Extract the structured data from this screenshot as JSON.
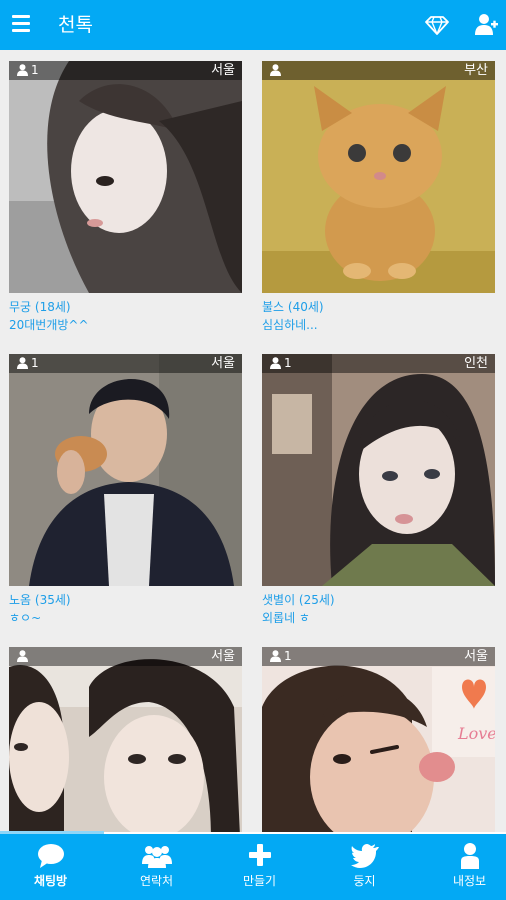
{
  "app": {
    "title": "천톡"
  },
  "header_icons": [
    "menu-icon",
    "diamond-icon",
    "add-user-icon"
  ],
  "rooms": [
    {
      "region": "서울",
      "count": "1",
      "name_age": "무궁 (18세)",
      "message": "20대번개방^^"
    },
    {
      "region": "부산",
      "count": "",
      "name_age": "불스 (40세)",
      "message": "심심하네..."
    },
    {
      "region": "서울",
      "count": "1",
      "name_age": "노옴 (35세)",
      "message": "ㅎㅇ~"
    },
    {
      "region": "인천",
      "count": "1",
      "name_age": "샛별이 (25세)",
      "message": "외롭네 ㅎ"
    },
    {
      "region": "서울",
      "count": "",
      "name_age": "",
      "message": ""
    },
    {
      "region": "서울",
      "count": "1",
      "name_age": "",
      "message": ""
    }
  ],
  "bottom_nav": [
    {
      "label": "채팅방",
      "icon": "chat-bubble-icon",
      "active": true
    },
    {
      "label": "연락처",
      "icon": "contacts-icon",
      "active": false
    },
    {
      "label": "만들기",
      "icon": "plus-icon",
      "active": false
    },
    {
      "label": "둥지",
      "icon": "twitter-bird-icon",
      "active": false
    },
    {
      "label": "내정보",
      "icon": "person-icon",
      "active": false
    }
  ],
  "colors": {
    "primary": "#03a9f4",
    "caption": "#1e9ee8",
    "background": "#eeeeee"
  }
}
